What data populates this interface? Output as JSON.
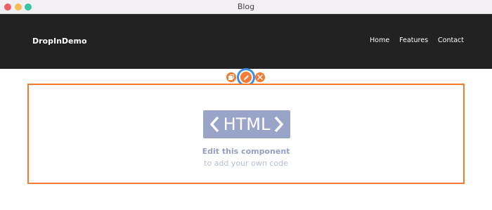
{
  "window": {
    "title": "Blog",
    "controls": [
      "close",
      "minimize",
      "maximize"
    ]
  },
  "navbar": {
    "brand": "DropInDemo",
    "links": [
      "Home",
      "Features",
      "Contact"
    ],
    "background": "#222222"
  },
  "toolbar": {
    "buttons": [
      {
        "name": "copy",
        "icon": "copy-icon"
      },
      {
        "name": "edit",
        "icon": "pencil-icon",
        "active": true
      },
      {
        "name": "delete",
        "icon": "close-icon"
      }
    ],
    "accent": "#f47b32",
    "focus_ring": "#3e8ee6"
  },
  "component": {
    "badge_text": "HTML",
    "title": "Edit this component",
    "subtitle": "to add your own code",
    "badge_color": "#9aa4c8"
  }
}
